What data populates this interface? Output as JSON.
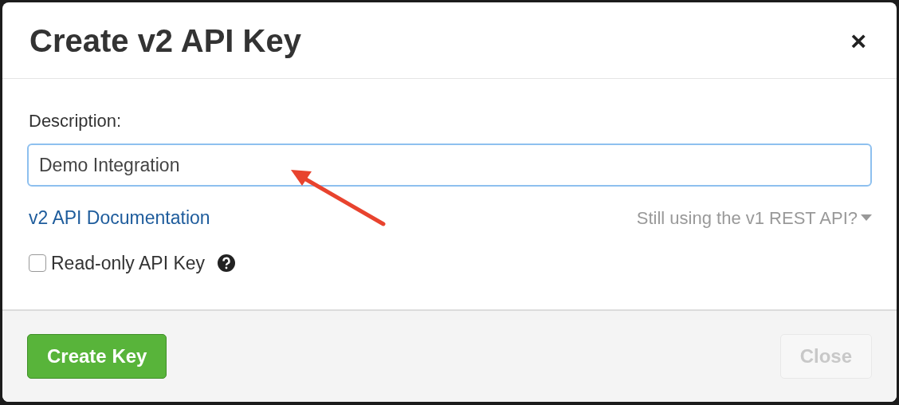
{
  "dialog": {
    "title": "Create v2 API Key",
    "close_glyph": "×"
  },
  "description": {
    "label": "Description:",
    "value": "Demo Integration"
  },
  "links": {
    "documentation": "v2 API Documentation",
    "v1_toggle": "Still using the v1 REST API?"
  },
  "readonly": {
    "label": "Read-only API Key",
    "checked": false
  },
  "buttons": [
    {
      "kind": "primary",
      "label": "Create Key",
      "disabled": false
    },
    {
      "kind": "secondary",
      "label": "Close",
      "disabled": true
    }
  ]
}
